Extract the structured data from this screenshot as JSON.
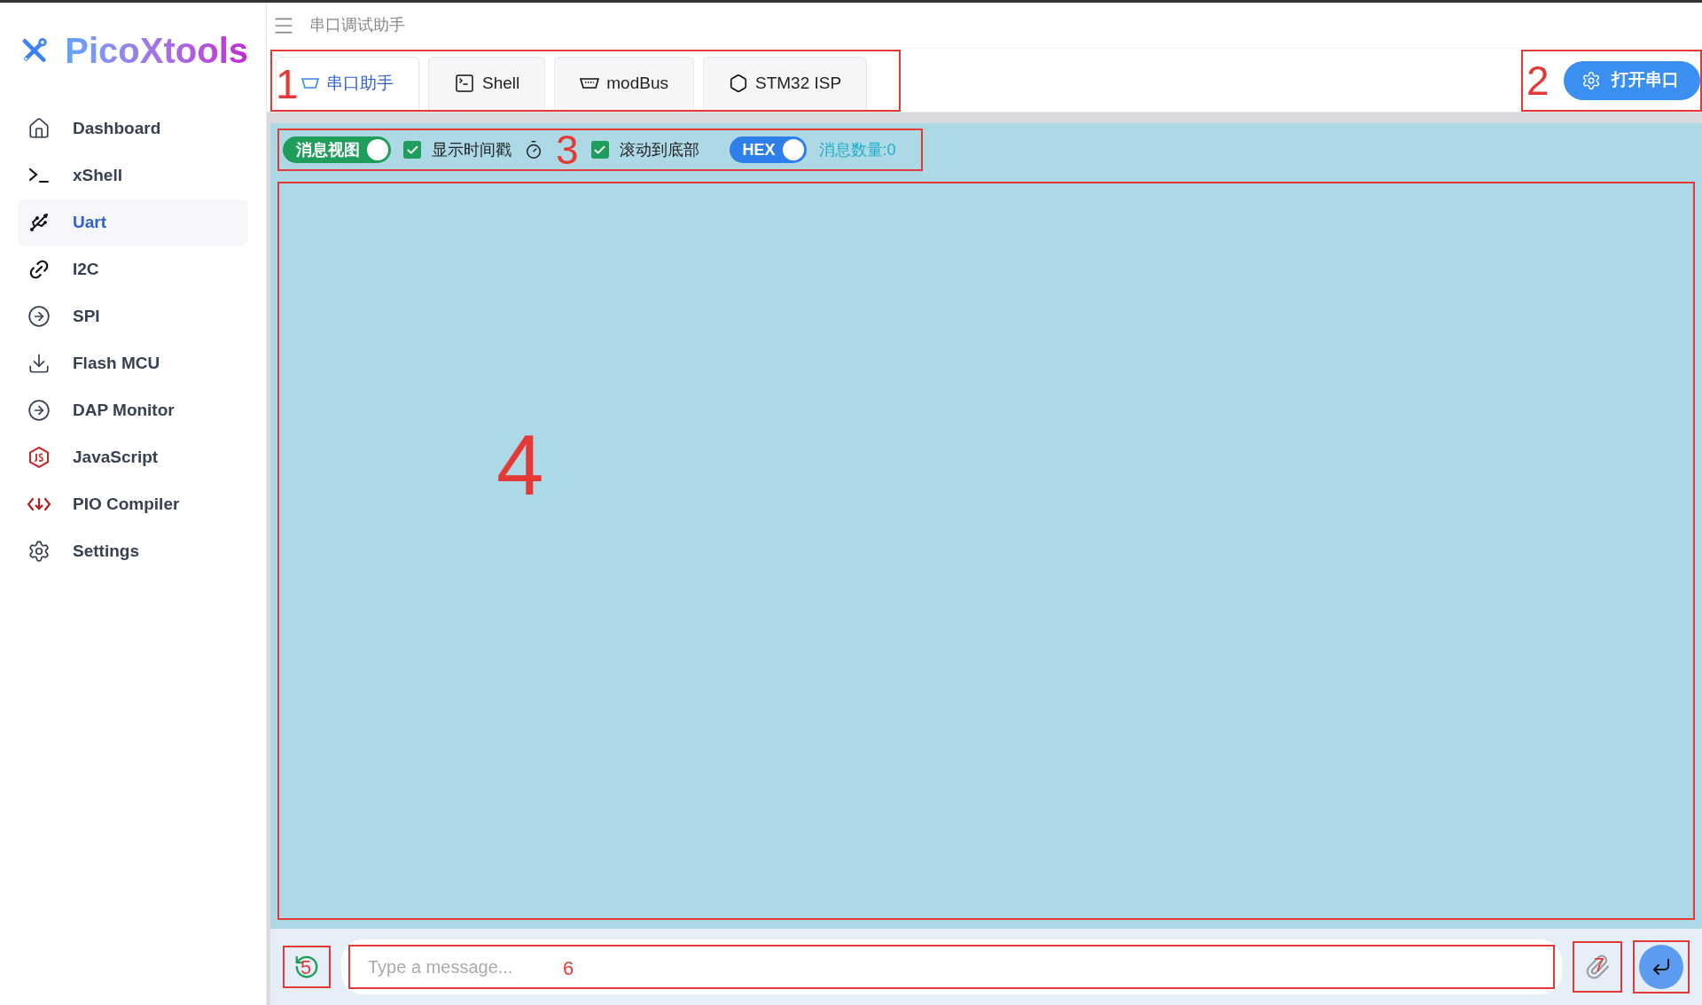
{
  "sidebar": {
    "logo": "PicoXtools",
    "items": [
      {
        "label": "Dashboard",
        "selected": false
      },
      {
        "label": "xShell",
        "selected": false
      },
      {
        "label": "Uart",
        "selected": true
      },
      {
        "label": "I2C",
        "selected": false
      },
      {
        "label": "SPI",
        "selected": false
      },
      {
        "label": "Flash MCU",
        "selected": false
      },
      {
        "label": "DAP Monitor",
        "selected": false
      },
      {
        "label": "JavaScript",
        "selected": false
      },
      {
        "label": "PIO Compiler",
        "selected": false
      },
      {
        "label": "Settings",
        "selected": false
      }
    ]
  },
  "header": {
    "title": "串口调试助手"
  },
  "tabs": [
    {
      "label": "串口助手",
      "selected": true
    },
    {
      "label": "Shell",
      "selected": false
    },
    {
      "label": "modBus",
      "selected": false
    },
    {
      "label": "STM32 ISP",
      "selected": false
    }
  ],
  "open_button": "打开串口",
  "toolbar": {
    "message_view": {
      "label": "消息视图",
      "on": true
    },
    "timestamp": {
      "label": "显示时间戳",
      "checked": true
    },
    "scroll_to_bottom": {
      "label": "滚动到底部",
      "checked": true
    },
    "hex": {
      "label": "HEX",
      "on": true
    },
    "count": "消息数量:0"
  },
  "input": {
    "placeholder": "Type a message..."
  },
  "annotations": [
    "1",
    "2",
    "3",
    "4",
    "5",
    "6",
    "7"
  ]
}
